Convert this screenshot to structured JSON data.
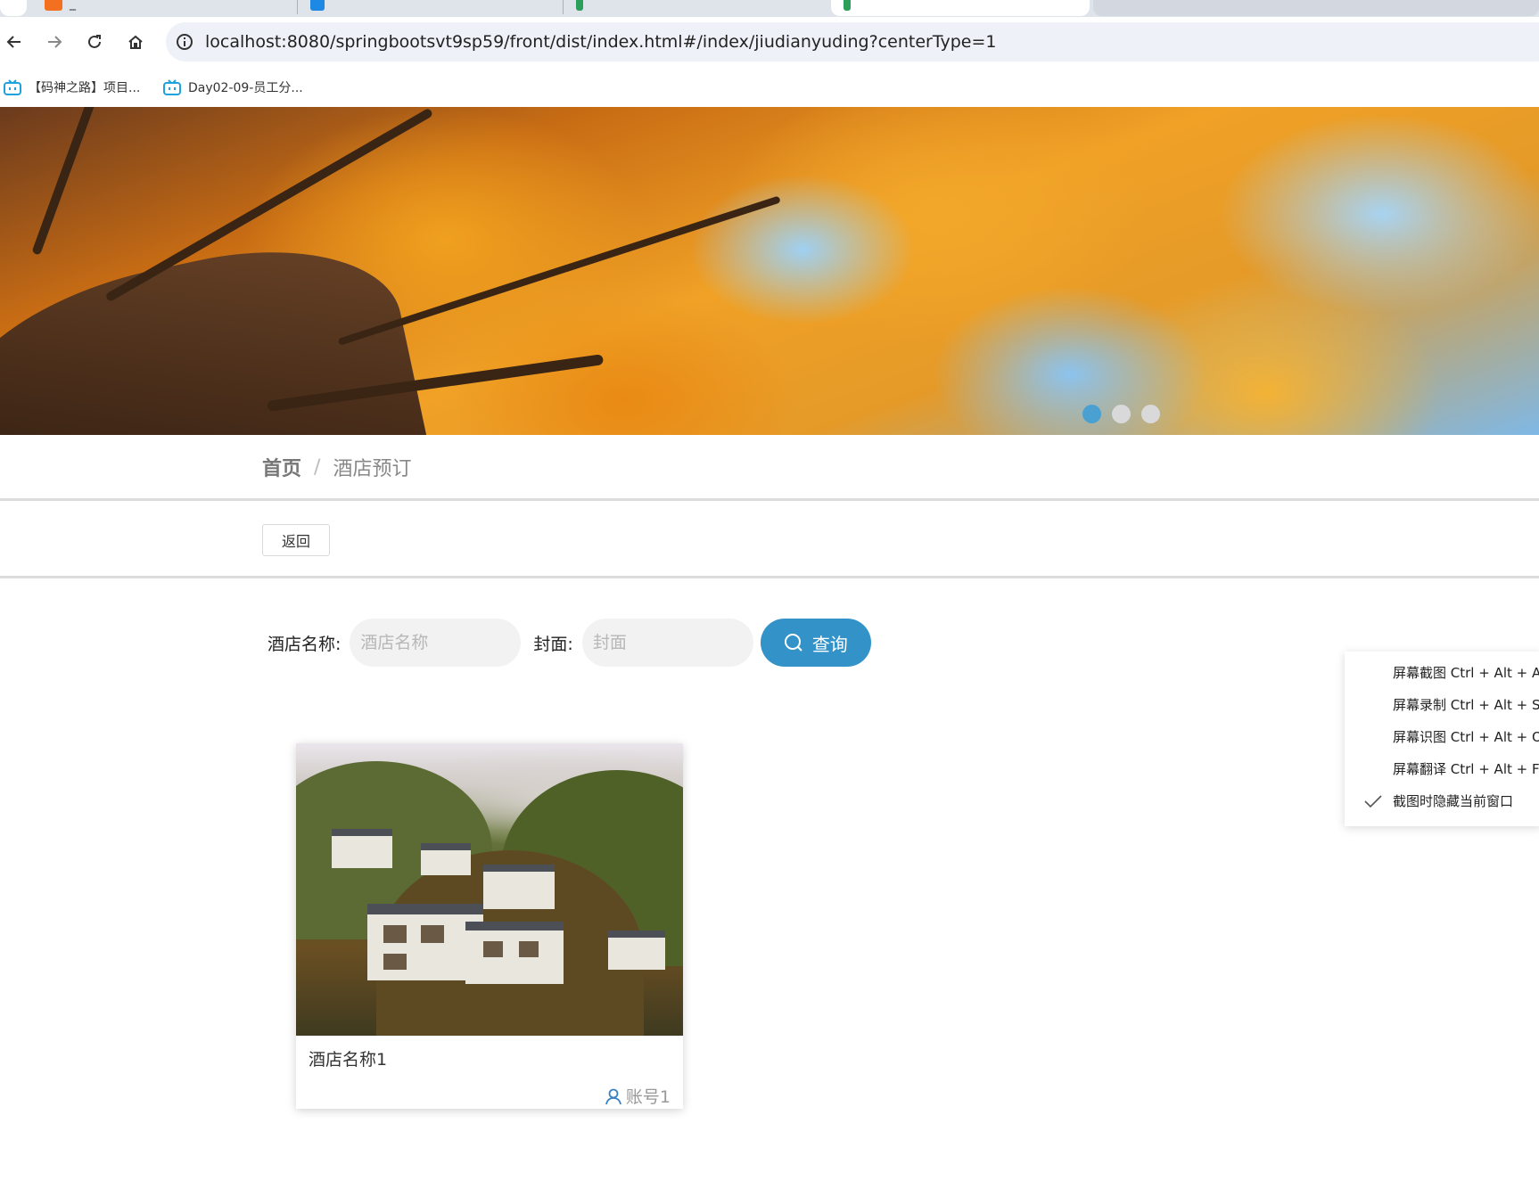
{
  "browser": {
    "tabs": [
      {
        "label": "_"
      },
      {
        "label": ""
      },
      {
        "label": ""
      },
      {
        "label": ""
      }
    ],
    "url": "localhost:8080/springbootsvt9sp59/front/dist/index.html#/index/jiudianyuding?centerType=1",
    "bookmarks": [
      {
        "label": "【码神之路】项目..."
      },
      {
        "label": "Day02-09-员工分..."
      }
    ]
  },
  "banner": {
    "carousel_count": 3,
    "active_index": 0
  },
  "breadcrumb": {
    "home": "首页",
    "separator": "/",
    "current": "酒店预订"
  },
  "toolbar": {
    "back_label": "返回"
  },
  "search": {
    "name_label": "酒店名称:",
    "name_placeholder": "酒店名称",
    "cover_label": "封面:",
    "cover_placeholder": "封面",
    "submit_label": "查询"
  },
  "hotels": [
    {
      "name": "酒店名称1",
      "account": "账号1"
    }
  ],
  "context_menu": {
    "items": [
      {
        "label": "屏幕截图 Ctrl + Alt + A",
        "checked": false
      },
      {
        "label": "屏幕录制 Ctrl + Alt + S",
        "checked": false
      },
      {
        "label": "屏幕识图 Ctrl + Alt + O",
        "checked": false
      },
      {
        "label": "屏幕翻译 Ctrl + Alt + F",
        "checked": false
      },
      {
        "label": "截图时隐藏当前窗口",
        "checked": true
      }
    ]
  },
  "colors": {
    "accent": "#3393c9",
    "carousel_active": "#4aa1d1"
  }
}
